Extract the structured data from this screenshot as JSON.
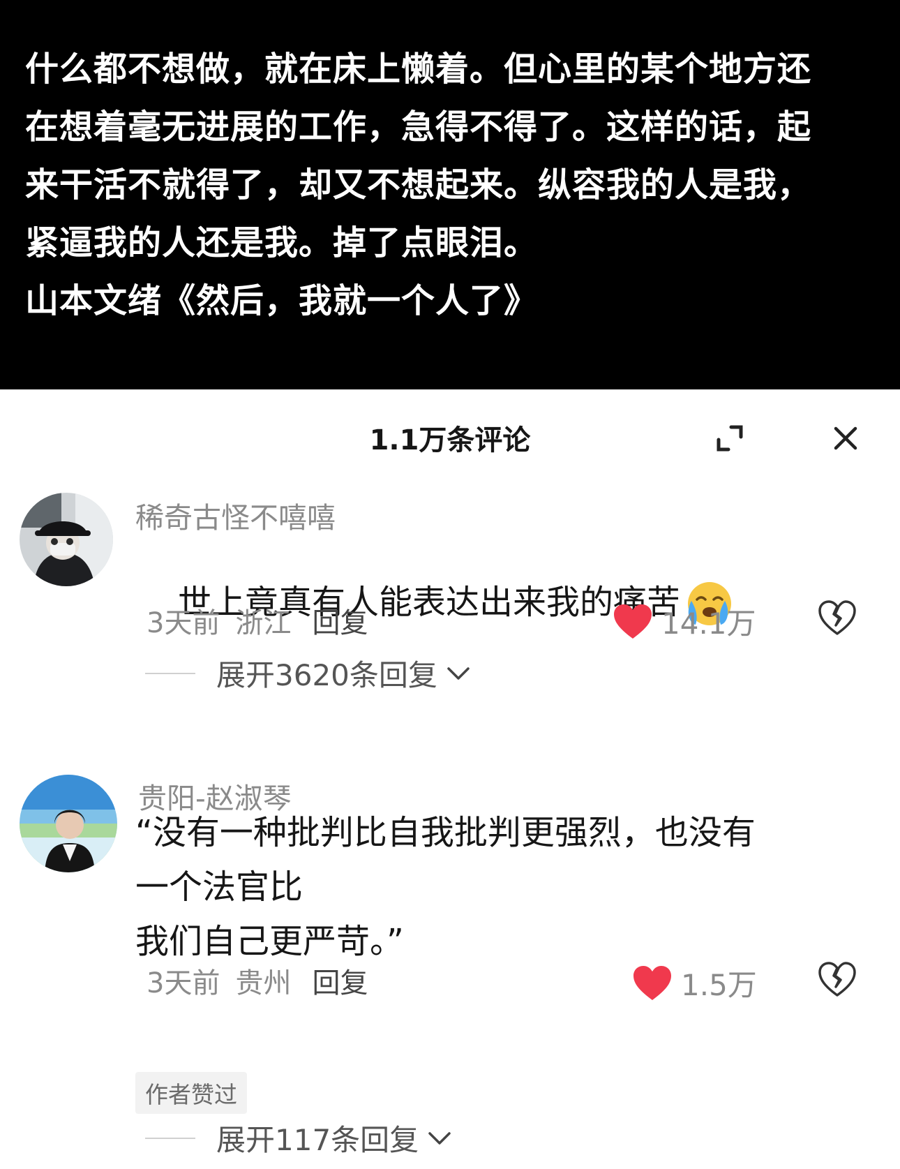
{
  "quote": {
    "text": "什么都不想做，就在床上懒着。但心里的某个地方还\n在想着毫无进展的工作，急得不得了。这样的话，起\n来干活不就得了，却又不想起来。纵容我的人是我，\n紧逼我的人还是我。掉了点眼泪。\n山本文绪《然后，我就一个人了》"
  },
  "panel": {
    "title": "1.1万条评论"
  },
  "comments": [
    {
      "username": "稀奇古怪不嘻嘻",
      "content": "世上竟真有人能表达出来我的痛苦",
      "emoji": "crying-emoji",
      "time": "3天前",
      "location": "浙江",
      "reply_label": "回复",
      "likes": "14.1万",
      "expand_label": "展开3620条回复"
    },
    {
      "username": "贵阳-赵淑琴",
      "content": "“没有一种批判比自我批判更强烈，也没有\n一个法官比\n我们自己更严苛。”",
      "time": "3天前",
      "location": "贵州",
      "reply_label": "回复",
      "likes": "1.5万",
      "badge": "作者赞过",
      "expand_label": "展开117条回复"
    }
  ],
  "colors": {
    "like_red": "#f0394d",
    "text_dark": "#161616",
    "text_gray": "#8a8a8a"
  }
}
